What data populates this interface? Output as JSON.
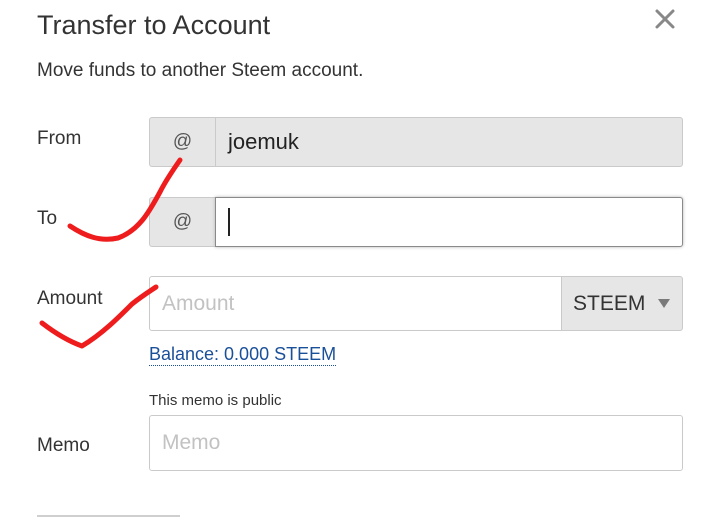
{
  "dialog": {
    "title": "Transfer to Account",
    "subtitle": "Move funds to another Steem account.",
    "close_icon": "close-icon"
  },
  "form": {
    "from": {
      "label": "From",
      "prefix": "@",
      "value": "joemuk"
    },
    "to": {
      "label": "To",
      "prefix": "@",
      "value": ""
    },
    "amount": {
      "label": "Amount",
      "placeholder": "Amount",
      "asset": "STEEM",
      "balance": "Balance: 0.000 STEEM"
    },
    "memo": {
      "label": "Memo",
      "note": "This memo is public",
      "placeholder": "Memo"
    }
  },
  "annotation_color": "#ee1c1c"
}
